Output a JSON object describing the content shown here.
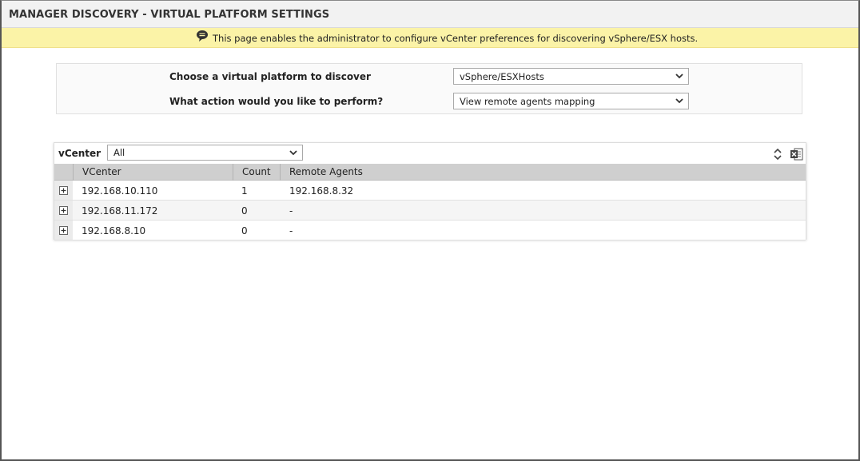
{
  "header": {
    "title": "MANAGER DISCOVERY - VIRTUAL PLATFORM SETTINGS"
  },
  "info": {
    "icon": "speech-bubble-icon",
    "message": "This page enables the administrator to configure vCenter preferences for discovering vSphere/ESX hosts."
  },
  "form": {
    "platform_label": "Choose a virtual platform to discover",
    "platform_value": "vSphere/ESXHosts",
    "action_label": "What action would you like to perform?",
    "action_value": "View remote agents mapping"
  },
  "grid": {
    "filter_label": "vCenter",
    "filter_value": "All",
    "columns": [
      "VCenter",
      "Count",
      "Remote Agents"
    ],
    "rows": [
      {
        "vcenter": "192.168.10.110",
        "count": "1",
        "agents": "192.168.8.32"
      },
      {
        "vcenter": "192.168.11.172",
        "count": "0",
        "agents": "-"
      },
      {
        "vcenter": "192.168.8.10",
        "count": "0",
        "agents": "-"
      }
    ],
    "icons": {
      "sort": "sort-updown-icon",
      "export": "excel-export-icon"
    }
  },
  "colors": {
    "info_bg": "#fbf3a7",
    "header_bg": "#f2f2f2",
    "grid_header_bg": "#cfcfcf"
  }
}
